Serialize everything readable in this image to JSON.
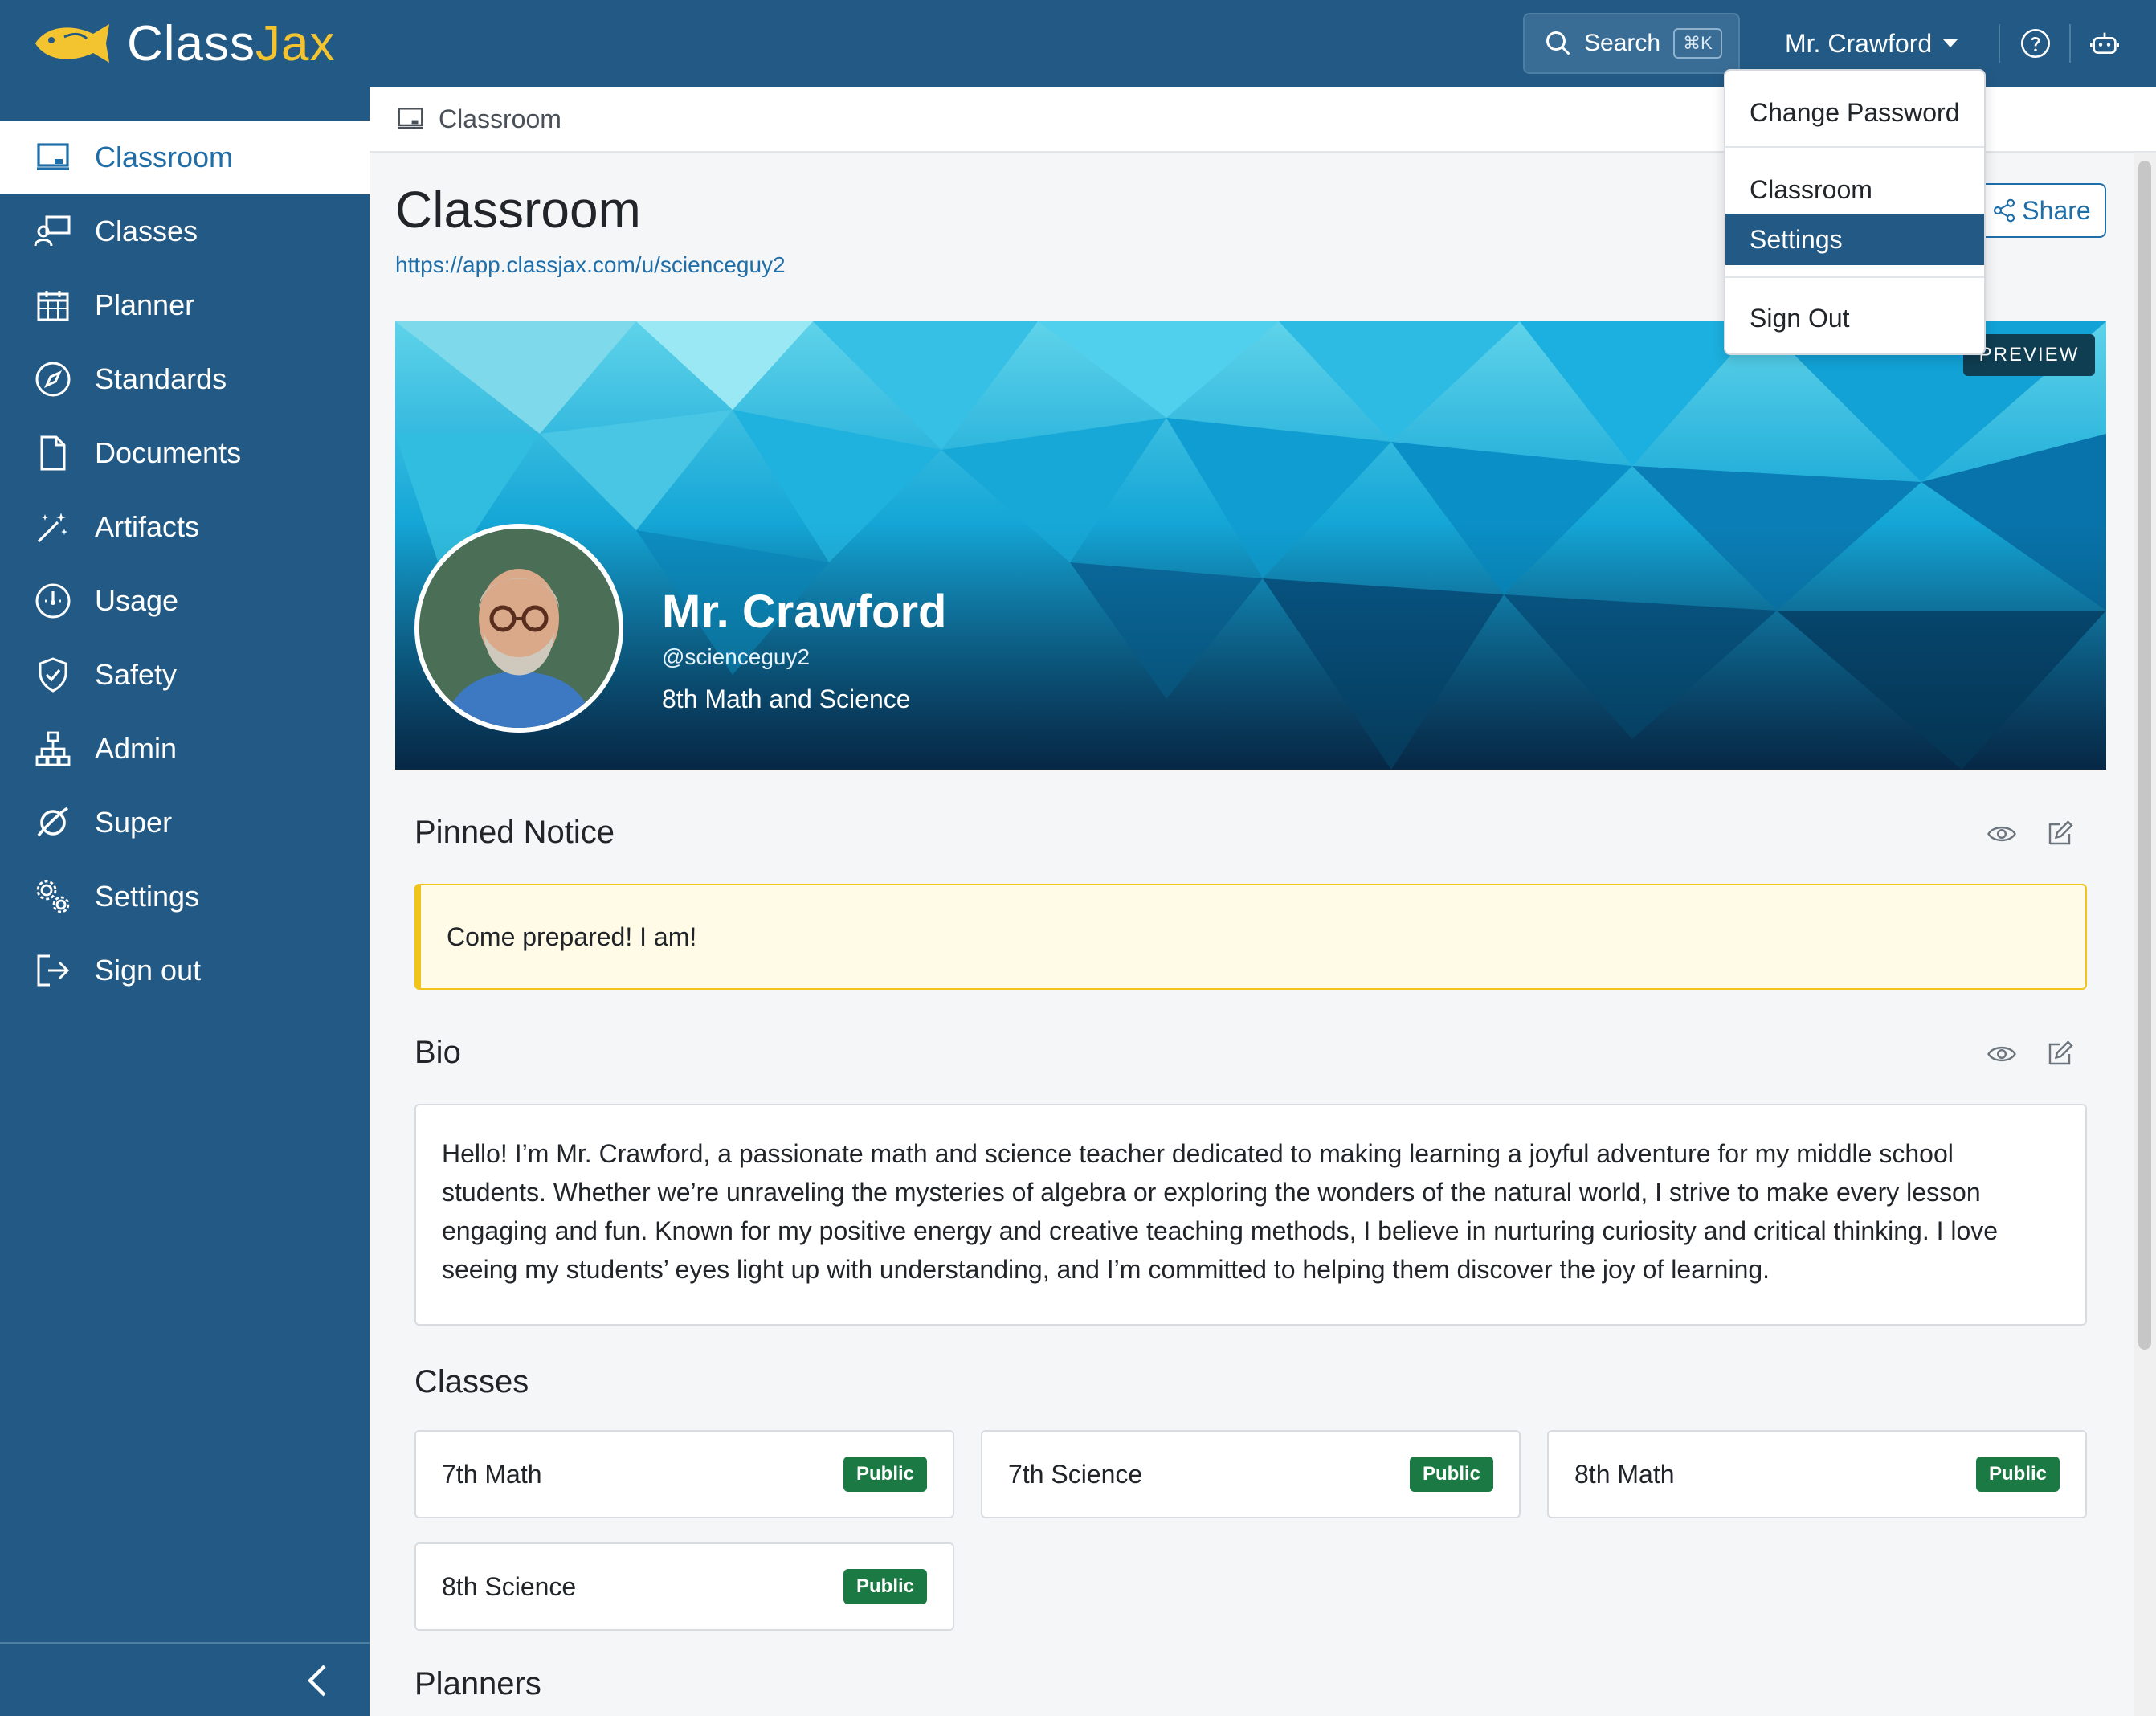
{
  "brand": {
    "class": "Class",
    "jax": "Jax"
  },
  "topbar": {
    "search_label": "Search",
    "search_shortcut": "⌘K",
    "user_name": "Mr. Crawford"
  },
  "dropdown": {
    "items": [
      "Change Password",
      "Classroom",
      "Settings",
      "Sign Out"
    ],
    "active": "Settings"
  },
  "sidebar": {
    "items": [
      {
        "label": "Classroom",
        "icon": "classroom-icon",
        "active": true
      },
      {
        "label": "Classes",
        "icon": "classes-icon"
      },
      {
        "label": "Planner",
        "icon": "calendar-icon"
      },
      {
        "label": "Standards",
        "icon": "compass-icon"
      },
      {
        "label": "Documents",
        "icon": "document-icon"
      },
      {
        "label": "Artifacts",
        "icon": "magic-wand-icon"
      },
      {
        "label": "Usage",
        "icon": "gauge-icon"
      },
      {
        "label": "Safety",
        "icon": "shield-check-icon"
      },
      {
        "label": "Admin",
        "icon": "hierarchy-icon"
      },
      {
        "label": "Super",
        "icon": "orbit-icon"
      },
      {
        "label": "Settings",
        "icon": "gears-icon"
      },
      {
        "label": "Sign out",
        "icon": "sign-out-icon"
      }
    ]
  },
  "breadcrumb": {
    "label": "Classroom"
  },
  "page": {
    "title": "Classroom",
    "url": "https://app.classjax.com/u/scienceguy2",
    "share_label": "Share"
  },
  "banner": {
    "preview_label": "PREVIEW",
    "name": "Mr. Crawford",
    "handle": "@scienceguy2",
    "subtitle": "8th Math and Science"
  },
  "pinned": {
    "title": "Pinned Notice",
    "text": "Come prepared! I am!"
  },
  "bio": {
    "title": "Bio",
    "text": "Hello! I’m Mr. Crawford, a passionate math and science teacher dedicated to making learning a joyful adventure for my middle school students. Whether we’re unraveling the mysteries of algebra or exploring the wonders of the natural world, I strive to make every lesson engaging and fun. Known for my positive energy and creative teaching methods, I believe in nurturing curiosity and critical thinking. I love seeing my students’ eyes light up with understanding, and I’m committed to helping them discover the joy of learning."
  },
  "classes": {
    "title": "Classes",
    "items": [
      {
        "name": "7th Math",
        "badge": "Public"
      },
      {
        "name": "7th Science",
        "badge": "Public"
      },
      {
        "name": "8th Math",
        "badge": "Public"
      },
      {
        "name": "8th Science",
        "badge": "Public"
      }
    ]
  },
  "planners": {
    "title": "Planners"
  },
  "colors": {
    "navy": "#235a85",
    "accent": "#1f6ea8",
    "badge_green": "#1b7a43",
    "notice_border": "#f0c419",
    "brand_yellow": "#f4c430"
  }
}
